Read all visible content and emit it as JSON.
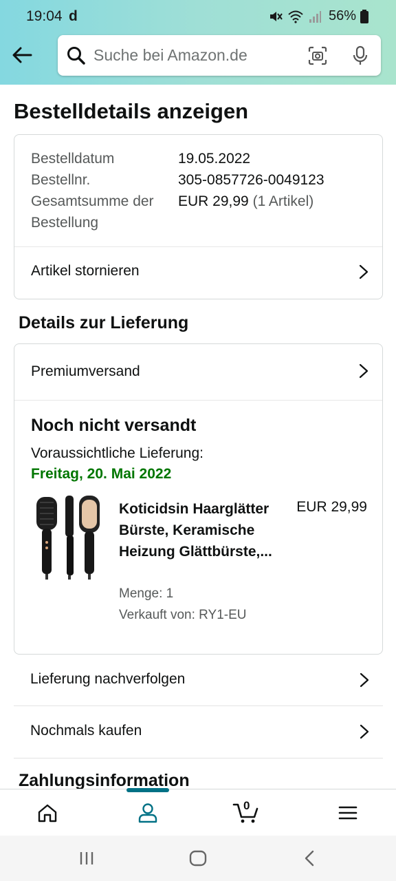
{
  "status_bar": {
    "time": "19:04",
    "carrier_glyph": "d",
    "battery": "56%"
  },
  "search": {
    "placeholder": "Suche bei Amazon.de"
  },
  "page": {
    "title": "Bestelldetails anzeigen"
  },
  "order_summary": {
    "rows": [
      {
        "label": "Bestelldatum",
        "value": "19.05.2022",
        "extra": ""
      },
      {
        "label": "Bestellnr.",
        "value": "305-0857726-0049123",
        "extra": ""
      },
      {
        "label": "Gesamtsumme der Bestellung",
        "value": "EUR 29,99",
        "extra": "(1 Artikel)"
      }
    ],
    "cancel_label": "Artikel stornieren"
  },
  "delivery": {
    "section_title": "Details zur Lieferung",
    "shipping_method": "Premiumversand",
    "status": "Noch nicht versandt",
    "eta_label": "Voraussichtliche Lieferung:",
    "eta_date": "Freitag, 20. Mai 2022",
    "item": {
      "title": "Koticidsin Haarglätter Bürste, Keramische Heizung Glättbürste,...",
      "price": "EUR 29,99",
      "quantity": "Menge: 1",
      "seller": "Verkauft von: RY1-EU"
    }
  },
  "actions": {
    "track": "Lieferung nachverfolgen",
    "buy_again": "Nochmals kaufen"
  },
  "payment": {
    "section_title": "Zahlungsinformation"
  },
  "bottom_nav": {
    "cart_count": "0",
    "items": [
      "home-icon",
      "account-icon",
      "cart-icon",
      "menu-icon"
    ]
  },
  "colors": {
    "header_gradient_start": "#84d8e0",
    "header_gradient_end": "#a9e4cd",
    "delivery_green": "#007600",
    "nav_active": "#007185"
  }
}
